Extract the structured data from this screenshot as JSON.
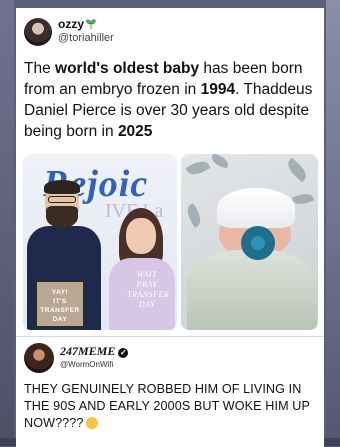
{
  "post": {
    "author_name": "ozzy",
    "author_handle": "@toriahiller",
    "text_parts": {
      "p1": "The ",
      "b1": "world's oldest baby",
      "p2": " has been born from an embryo frozen in ",
      "b2": "1994",
      "p3": ". Thaddeus Daniel Pierce is over 30 years old despite being born in ",
      "b3": "2025"
    },
    "photo_left": {
      "wall_text": "Rejoic",
      "wall_text_2": "IVF La",
      "sign_text": [
        "YAY!",
        "IT'S",
        "TRANSFER",
        "DAY"
      ],
      "shirt_text": [
        "WAIT",
        "PRAY",
        "TRANSFER",
        "DAY"
      ]
    }
  },
  "reply": {
    "author_name": "247MEME",
    "author_handle": "@WormOnWifi",
    "text": "THEY GENUINELY ROBBED HIM OF LIVING IN THE 90S AND EARLY 2000S BUT WOKE HIM UP NOW????",
    "emoji": "laughing-emoji"
  },
  "colors": {
    "background": "#5c5f78",
    "card": "#ffffff",
    "text": "#111111"
  }
}
